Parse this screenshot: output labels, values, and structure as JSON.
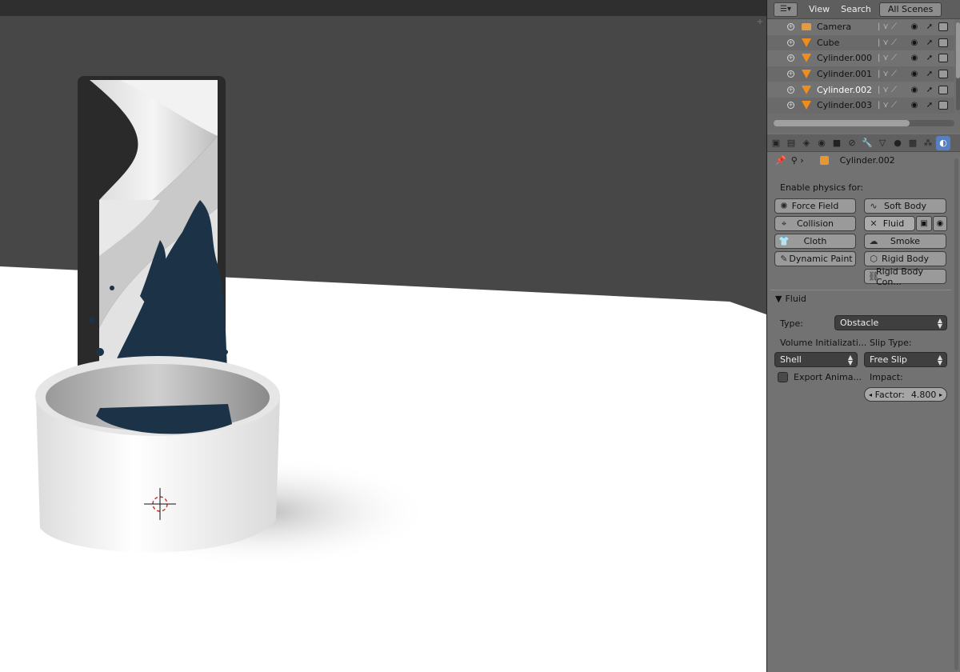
{
  "outliner": {
    "header": {
      "view": "View",
      "search": "Search",
      "scene_filter": "All Scenes"
    },
    "rows": [
      {
        "name": "Camera",
        "type": "camera",
        "selected": false
      },
      {
        "name": "Cube",
        "type": "mesh",
        "selected": false
      },
      {
        "name": "Cylinder.000",
        "type": "mesh",
        "selected": false
      },
      {
        "name": "Cylinder.001",
        "type": "mesh",
        "selected": false
      },
      {
        "name": "Cylinder.002",
        "type": "mesh",
        "selected": true
      },
      {
        "name": "Cylinder.003",
        "type": "mesh",
        "selected": false
      }
    ]
  },
  "properties": {
    "context_object": "Cylinder.002",
    "enable_label": "Enable physics for:",
    "buttons": {
      "force_field": "Force Field",
      "soft_body": "Soft Body",
      "collision": "Collision",
      "fluid": "Fluid",
      "cloth": "Cloth",
      "smoke": "Smoke",
      "dynamic_paint": "Dynamic Paint",
      "rigid_body": "Rigid Body",
      "rigid_body_con": "Rigid Body Con..."
    },
    "fluid_panel": {
      "title": "Fluid",
      "type_label": "Type:",
      "type_value": "Obstacle",
      "volume_label": "Volume Initializati...",
      "volume_value": "Shell",
      "slip_label": "Slip Type:",
      "slip_value": "Free Slip",
      "export_label": "Export Anima...",
      "impact_label": "Impact:",
      "factor_label": "Factor:",
      "factor_value": "4.800"
    }
  },
  "colors": {
    "accent": "#5680c2",
    "mesh_icon": "#f08c1c",
    "fluid_dark": "#1c3347"
  }
}
